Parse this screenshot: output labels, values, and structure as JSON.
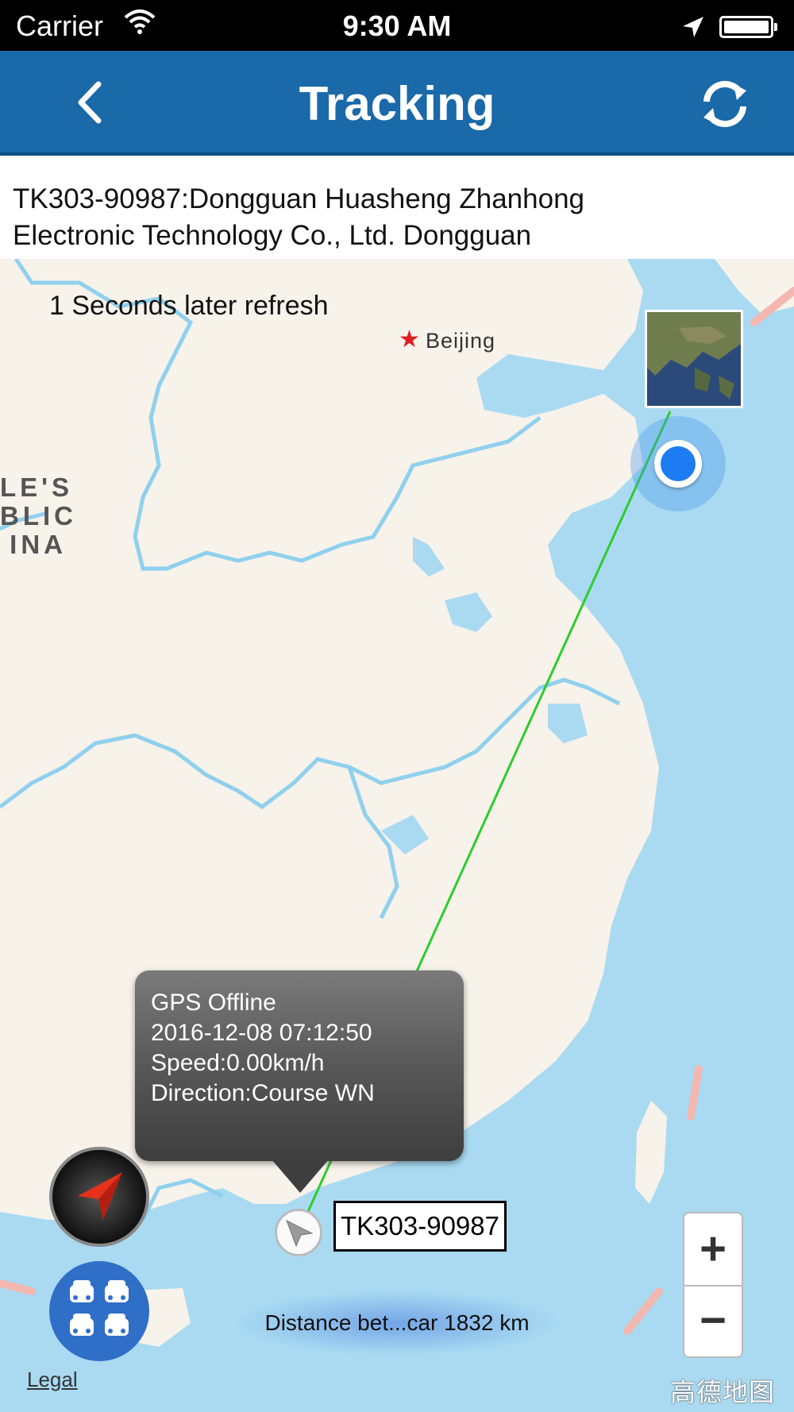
{
  "status_bar": {
    "carrier": "Carrier",
    "time": "9:30 AM",
    "icons": [
      "wifi-icon",
      "location-arrow-icon",
      "battery-icon"
    ]
  },
  "nav": {
    "title": "Tracking",
    "back_icon": "chevron-left-icon",
    "refresh_icon": "refresh-icon"
  },
  "device": {
    "info_line1": "TK303-90987:Dongguan Huasheng Zhanhong",
    "info_line2": "Electronic Technology Co., Ltd. Dongguan"
  },
  "map": {
    "refresh_text": "1 Seconds later refresh",
    "city_label": "Beijing",
    "country_label_lines": [
      "LE'S",
      "BLIC",
      "INA"
    ],
    "satellite_toggle_icon": "satellite-thumbnail-icon",
    "popup": {
      "status": "GPS Offline",
      "timestamp": "2016-12-08 07:12:50",
      "speed": "Speed:0.00km/h",
      "direction": "Direction:Course WN"
    },
    "vehicle_label": "TK303-90987",
    "vehicle_icon": "navigation-arrow-icon",
    "compass_icon": "compass-icon",
    "all_cars_icon": "cars-icon",
    "distance_text": "Distance bet...car 1832 km",
    "zoom_in": "+",
    "zoom_out": "−",
    "legal": "Legal",
    "provider": "高德地图",
    "colors": {
      "sea": "#a9daf2",
      "land": "#f7f2ea",
      "border": "#8fd0ee",
      "track_line": "#2ecc2e",
      "user_dot": "#1d7cf2",
      "nav_bar": "#1a69a8"
    }
  }
}
